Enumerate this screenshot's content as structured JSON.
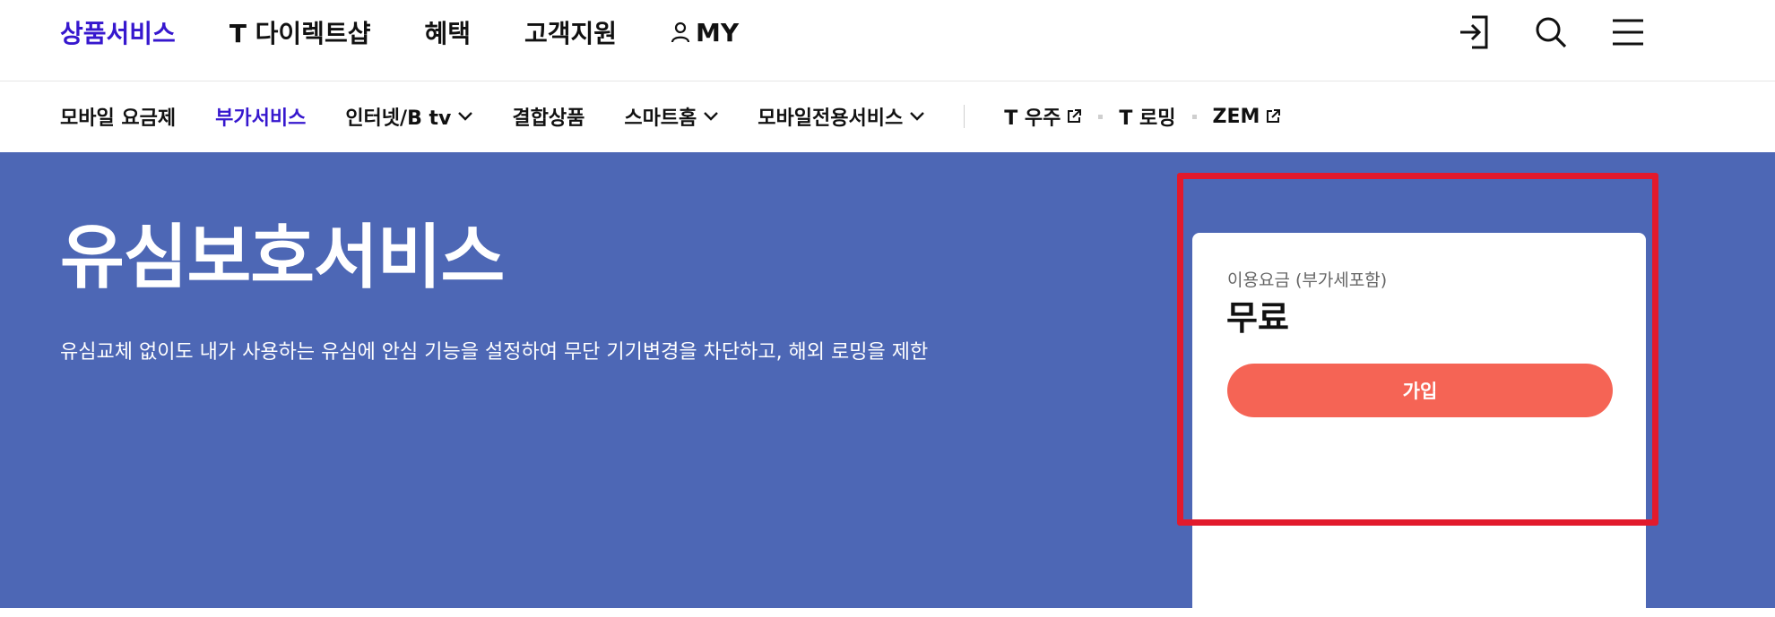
{
  "topnav": {
    "items": [
      {
        "label": "상품서비스"
      },
      {
        "label": "T 다이렉트샵"
      },
      {
        "label": "혜택"
      },
      {
        "label": "고객지원"
      },
      {
        "label": "MY"
      }
    ],
    "icons": [
      "login-icon",
      "search-icon",
      "menu-icon"
    ]
  },
  "subnav": {
    "items": [
      {
        "label": "모바일 요금제"
      },
      {
        "label": "부가서비스"
      },
      {
        "label": "인터넷/B tv"
      },
      {
        "label": "결합상품"
      },
      {
        "label": "스마트홈"
      },
      {
        "label": "모바일전용서비스"
      }
    ],
    "external": [
      {
        "label": "T 우주"
      },
      {
        "label": "T 로밍"
      },
      {
        "label": "ZEM"
      }
    ]
  },
  "hero": {
    "title": "유심보호서비스",
    "description": "유심교체 없이도 내가 사용하는 유심에 안심 기능을 설정하여 무단 기기변경을 차단하고, 해외 로밍을 제한"
  },
  "card": {
    "fee_label": "이용요금 (부가세포함)",
    "price": "무료",
    "join_label": "가입"
  },
  "colors": {
    "brand": "#3617ce",
    "hero_bg": "#4d67b5",
    "join_button": "#f56455",
    "highlight": "#e21a2c"
  }
}
